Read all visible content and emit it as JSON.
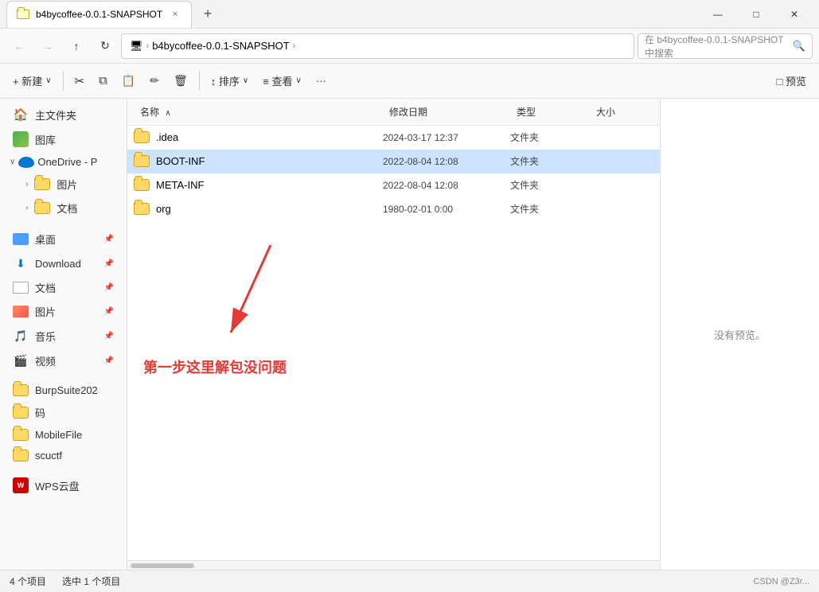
{
  "window": {
    "title": "b4bycoffee-0.0.1-SNAPSHOT",
    "tab_label": "b4bycoffee-0.0.1-SNAPSHOT",
    "tab_close": "×",
    "tab_new": "+",
    "btn_minimize": "—",
    "btn_maximize": "□",
    "btn_close": "✕"
  },
  "address_bar": {
    "back": "←",
    "forward": "→",
    "up": "↑",
    "refresh": "↻",
    "computer_icon": "🖥",
    "breadcrumb_sep": "›",
    "path_segment": "b4bycoffee-0.0.1-SNAPSHOT",
    "path_arrow": "›",
    "search_placeholder": "在 b4bycoffee-0.0.1-SNAPSHOT 中搜索",
    "search_icon": "🔍"
  },
  "toolbar": {
    "new_label": "+ 新建",
    "new_arrow": "∨",
    "cut_icon": "✂",
    "copy_icon": "⧉",
    "paste_icon": "📋",
    "rename_icon": "✏",
    "delete_icon": "🗑",
    "sort_label": "↕ 排序",
    "sort_arrow": "∨",
    "view_label": "≡ 查看",
    "view_arrow": "∨",
    "more_icon": "···",
    "preview_label": "□ 预览"
  },
  "sidebar": {
    "home_label": "主文件夹",
    "gallery_label": "图库",
    "onedrive_label": "OneDrive - P",
    "onedrive_arrow": "∨",
    "pictures_label": "图片",
    "documents_label": "文档",
    "desktop_label": "桌面",
    "downloads_label": "Download",
    "docs2_label": "文档",
    "images2_label": "图片",
    "music_label": "音乐",
    "video_label": "视频",
    "burpsuite_label": "BurpSuite202",
    "ma_label": "码",
    "mobilefile_label": "MobileFile",
    "scuctf_label": "scuctf",
    "wps_label": "WPS云盘"
  },
  "columns": {
    "name": "名称",
    "sort_arrow": "∧",
    "date": "修改日期",
    "type": "类型",
    "size": "大小"
  },
  "files": [
    {
      "name": ".idea",
      "date": "2024-03-17 12:37",
      "type": "文件夹",
      "size": "",
      "selected": false
    },
    {
      "name": "BOOT-INF",
      "date": "2022-08-04 12:08",
      "type": "文件夹",
      "size": "",
      "selected": true
    },
    {
      "name": "META-INF",
      "date": "2022-08-04 12:08",
      "type": "文件夹",
      "size": "",
      "selected": false
    },
    {
      "name": "org",
      "date": "1980-02-01 0:00",
      "type": "文件夹",
      "size": "",
      "selected": false
    }
  ],
  "preview": {
    "no_preview_text": "没有预览。"
  },
  "annotation": {
    "text": "第一步这里解包没问题",
    "arrow_color": "#e53935"
  },
  "status_bar": {
    "count_text": "4 个项目",
    "selected_text": "选中 1 个项目",
    "brand": "CSDN @Z3r..."
  }
}
